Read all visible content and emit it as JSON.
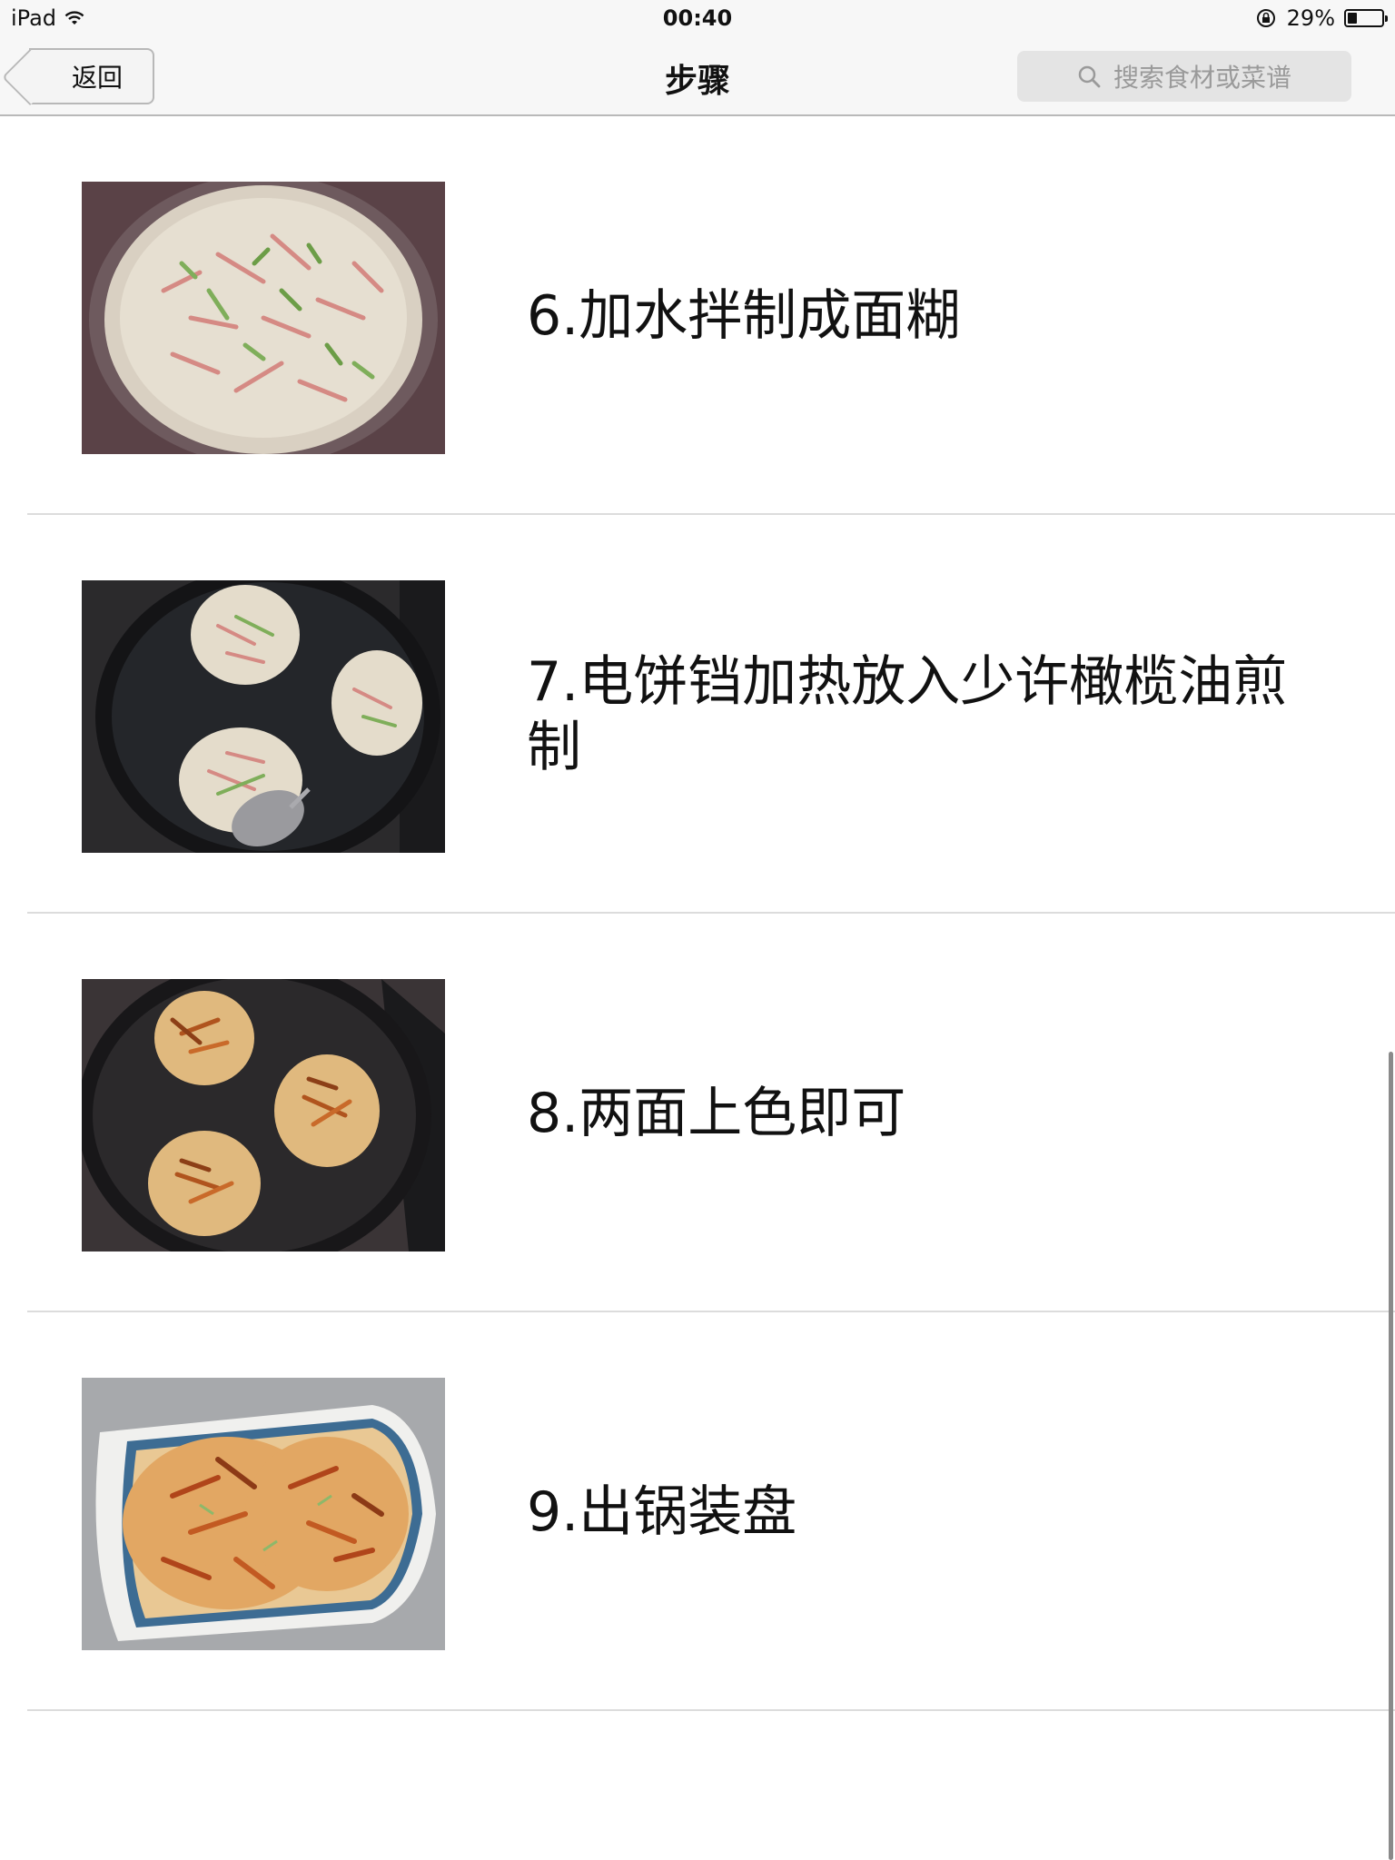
{
  "status_bar": {
    "device": "iPad",
    "time": "00:40",
    "battery_text": "29%",
    "battery_level": 0.29
  },
  "nav": {
    "back_label": "返回",
    "title": "步骤",
    "search_placeholder": "搜索食材或菜谱"
  },
  "steps": [
    {
      "text": "6.加水拌制成面糊",
      "photo": "batter-in-bowl"
    },
    {
      "text": "7.电饼铛加热放入少许橄榄油煎制",
      "photo": "pancakes-frying-in-pan"
    },
    {
      "text": "8.两面上色即可",
      "photo": "browned-pancakes-in-pan"
    },
    {
      "text": "9.出锅装盘",
      "photo": "pancakes-on-plate"
    }
  ],
  "colors": {
    "bar_background": "#f7f7f7",
    "divider": "#dcdcdc",
    "search_background": "#e4e4e4",
    "placeholder_text": "#9a9a9a"
  }
}
